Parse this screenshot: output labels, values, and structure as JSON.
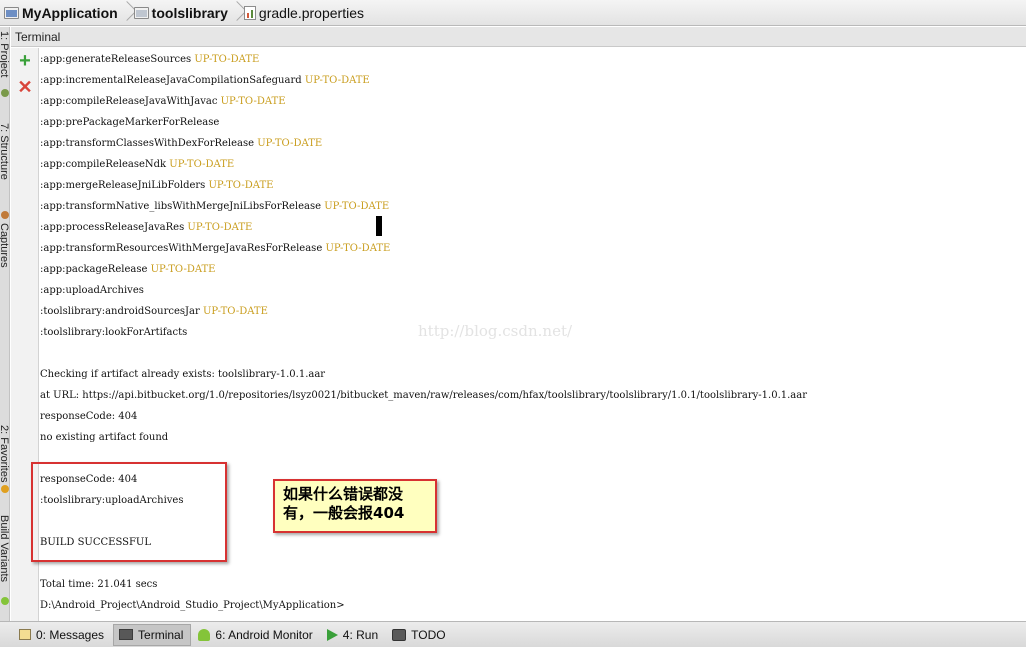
{
  "breadcrumb": {
    "items": [
      {
        "label": "MyApplication",
        "bold": true
      },
      {
        "label": "toolslibrary",
        "bold": true
      },
      {
        "label": "gradle.properties",
        "bold": false
      }
    ]
  },
  "left_strip": {
    "tabs": [
      "1: Project",
      "7: Structure",
      "Captures",
      "2: Favorites",
      "Build Variants"
    ]
  },
  "terminal": {
    "title": "Terminal",
    "lines": [
      {
        "text": ":app:generateReleaseSources",
        "status": "UP-TO-DATE"
      },
      {
        "text": ":app:incrementalReleaseJavaCompilationSafeguard",
        "status": "UP-TO-DATE"
      },
      {
        "text": ":app:compileReleaseJavaWithJavac",
        "status": "UP-TO-DATE"
      },
      {
        "text": ":app:prePackageMarkerForRelease",
        "status": ""
      },
      {
        "text": ":app:transformClassesWithDexForRelease",
        "status": "UP-TO-DATE"
      },
      {
        "text": ":app:compileReleaseNdk",
        "status": "UP-TO-DATE"
      },
      {
        "text": ":app:mergeReleaseJniLibFolders",
        "status": "UP-TO-DATE"
      },
      {
        "text": ":app:transformNative_libsWithMergeJniLibsForRelease",
        "status": "UP-TO-DATE"
      },
      {
        "text": ":app:processReleaseJavaRes",
        "status": "UP-TO-DATE"
      },
      {
        "text": ":app:transformResourcesWithMergeJavaResForRelease",
        "status": "UP-TO-DATE"
      },
      {
        "text": ":app:packageRelease",
        "status": "UP-TO-DATE"
      },
      {
        "text": ":app:uploadArchives",
        "status": ""
      },
      {
        "text": ":toolslibrary:androidSourcesJar",
        "status": "UP-TO-DATE"
      },
      {
        "text": ":toolslibrary:lookForArtifacts",
        "status": ""
      },
      {
        "text": "",
        "status": ""
      },
      {
        "text": "Checking if artifact already exists: toolslibrary-1.0.1.aar",
        "status": ""
      },
      {
        "text": "at URL: https://api.bitbucket.org/1.0/repositories/lsyz0021/bitbucket_maven/raw/releases/com/hfax/toolslibrary/toolslibrary/1.0.1/toolslibrary-1.0.1.aar",
        "status": ""
      },
      {
        "text": "responseCode: 404",
        "status": ""
      },
      {
        "text": "no existing artifact found",
        "status": ""
      },
      {
        "text": "",
        "status": ""
      },
      {
        "text": "responseCode: 404",
        "status": ""
      },
      {
        "text": ":toolslibrary:uploadArchives",
        "status": ""
      },
      {
        "text": "",
        "status": ""
      },
      {
        "text": "BUILD SUCCESSFUL",
        "status": ""
      },
      {
        "text": "",
        "status": ""
      },
      {
        "text": "Total time: 21.041 secs",
        "status": ""
      },
      {
        "text": "D:\\Android_Project\\Android_Studio_Project\\MyApplication>",
        "status": ""
      }
    ],
    "watermark": "http://blog.csdn.net/",
    "annotation": "如果什么错误都没有，一般会报404"
  },
  "bottom_bar": {
    "tabs": [
      {
        "label": "0: Messages",
        "icon": "messages-icon",
        "active": false
      },
      {
        "label": "Terminal",
        "icon": "terminal-icon",
        "active": true
      },
      {
        "label": "6: Android Monitor",
        "icon": "android-icon",
        "active": false
      },
      {
        "label": "4: Run",
        "icon": "run-icon",
        "active": false
      },
      {
        "label": "TODO",
        "icon": "todo-icon",
        "active": false
      }
    ]
  },
  "colors": {
    "status_text": "#c99d1d",
    "annotation_border": "#d73232",
    "annotation_fill": "#ffffbf"
  }
}
